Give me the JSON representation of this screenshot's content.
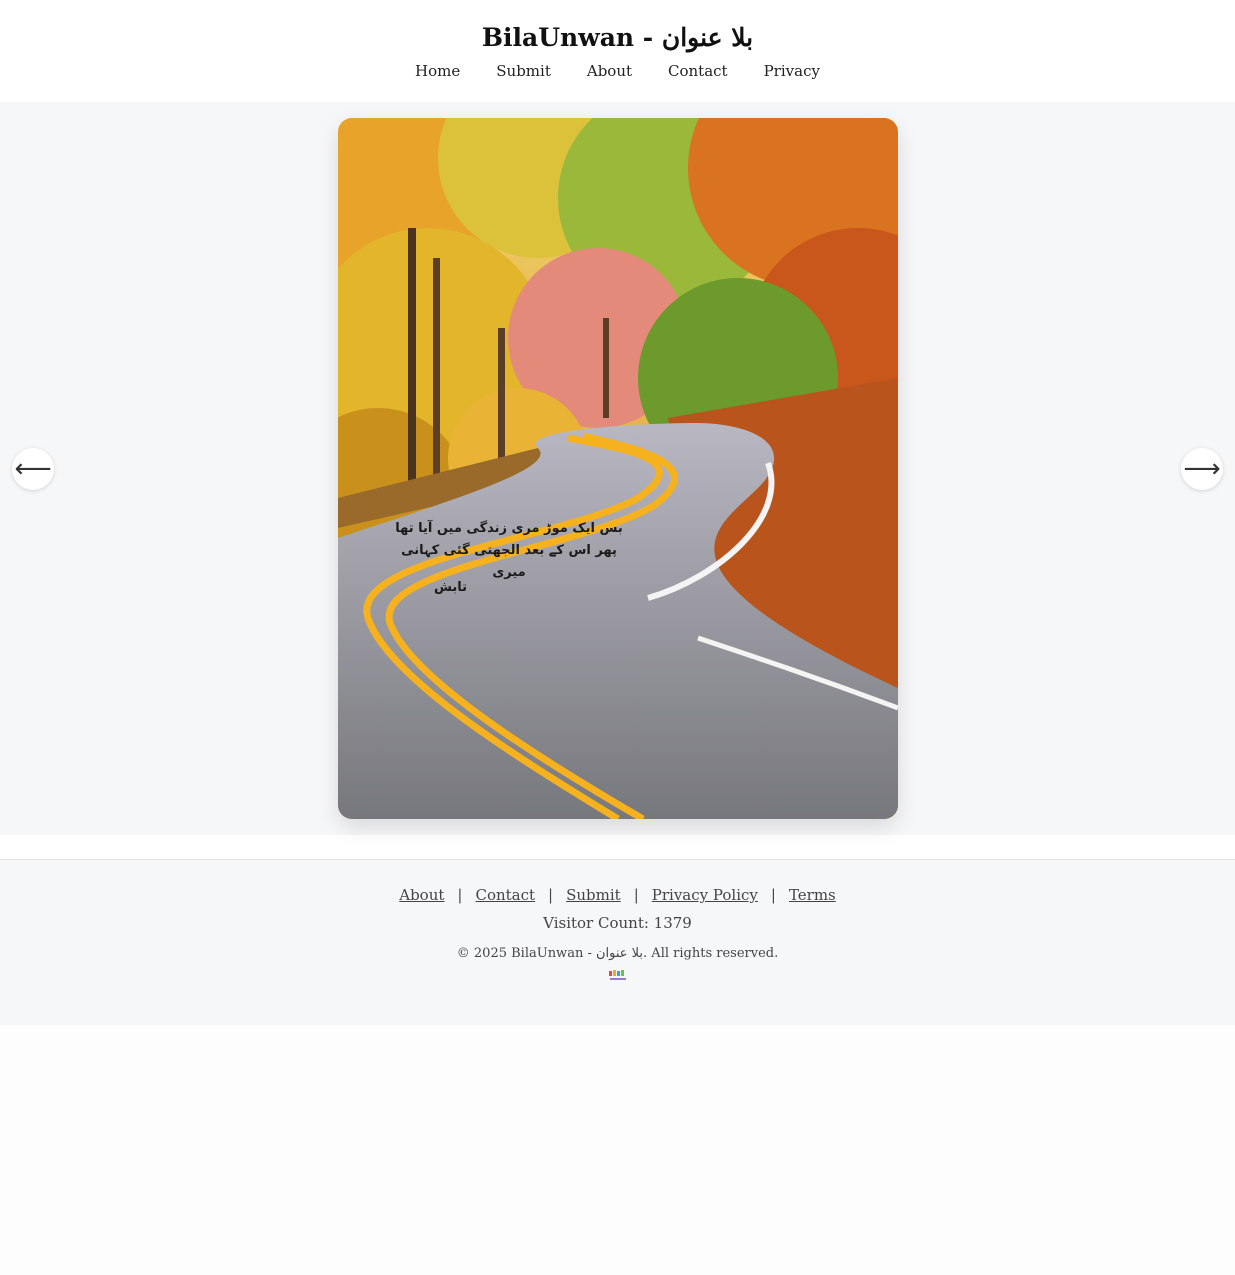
{
  "header": {
    "title": "BilaUnwan - بلا عنوان",
    "nav": [
      "Home",
      "Submit",
      "About",
      "Contact",
      "Privacy"
    ]
  },
  "slide": {
    "poem_lines": [
      "بس ایک موڑ  مری زندگی میں  آیا تھا",
      "پھر اس کے بعد الجھتی گئی کہانی میری"
    ],
    "author": "تابش"
  },
  "carousel": {
    "prev_icon": "arrow-left-icon",
    "prev_glyph": "⟵",
    "next_icon": "arrow-right-icon",
    "next_glyph": "⟶"
  },
  "footer": {
    "links": [
      "About",
      "Contact",
      "Submit",
      "Privacy Policy",
      "Terms"
    ],
    "separator": "|",
    "visitor_count": "Visitor Count: 1379",
    "copyright": "© 2025 BilaUnwan - بلا عنوان. All rights reserved."
  },
  "colors": {
    "header_bg": "#ffffff",
    "band_bg": "#f6f7f8",
    "road": "#8d8f96",
    "road_line": "#f5b21e",
    "foliage_orange": "#e0821c",
    "foliage_yellow": "#e9c429"
  }
}
